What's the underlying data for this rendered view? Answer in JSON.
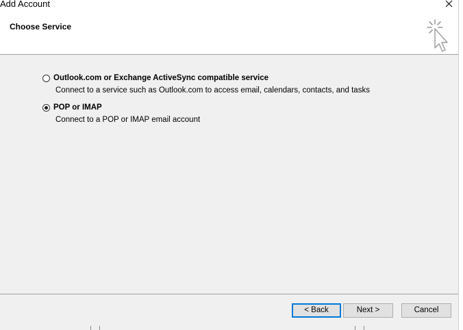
{
  "window": {
    "title": "Add Account",
    "close_icon": "close-icon"
  },
  "header": {
    "title": "Choose Service",
    "icon": "sparkle-cursor-icon"
  },
  "options": [
    {
      "label": "Outlook.com or Exchange ActiveSync compatible service",
      "description": "Connect to a service such as Outlook.com to access email, calendars, contacts, and tasks",
      "selected": false
    },
    {
      "label": "POP or IMAP",
      "description": "Connect to a POP or IMAP email account",
      "selected": true
    }
  ],
  "buttons": {
    "back": "< Back",
    "next": "Next >",
    "cancel": "Cancel"
  },
  "colors": {
    "content_bg": "#f0f0f0",
    "default_button_border": "#0078d7"
  }
}
